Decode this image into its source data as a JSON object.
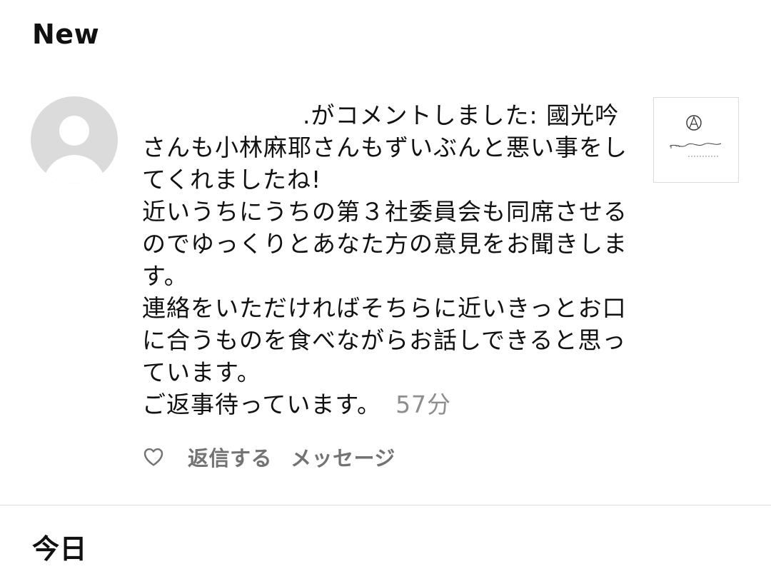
{
  "sections": {
    "new_title": "New",
    "today_title": "今日"
  },
  "notification": {
    "lines": [
      ".がコメントしました: 國光吟さんも小林麻耶さんもずいぶんと悪い事をしてくれましたね!",
      "近いうちにうちの第３社委員会も同席させるのでゆっくりとあなた方の意見をお聞きします。",
      "連絡をいただければそちらに近いきっとお口に合うものを食べながらお話しできると思っています。",
      "ご返事待っています。"
    ],
    "timestamp": "57分",
    "actions": {
      "reply": "返信する",
      "message": "メッセージ"
    }
  },
  "icons": {
    "avatar": "default-avatar-icon",
    "like": "heart-outline-icon",
    "thumbnail_logo": "circle-a-logo"
  },
  "colors": {
    "text": "#111111",
    "secondary": "#8e8e8e",
    "action": "#737373",
    "avatar_bg": "#dbdbdb",
    "divider": "#dbdbdb"
  }
}
